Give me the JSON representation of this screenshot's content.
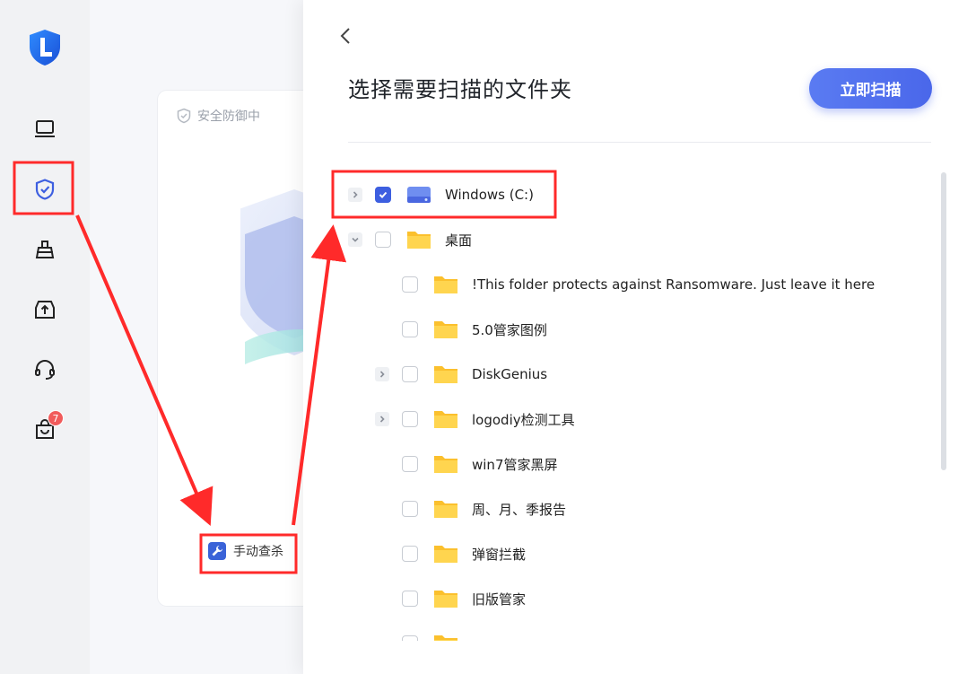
{
  "sidebar": {
    "items": [
      {
        "icon": "laptop-icon"
      },
      {
        "icon": "shield-check-icon"
      },
      {
        "icon": "broom-icon"
      },
      {
        "icon": "upload-box-icon"
      },
      {
        "icon": "headset-icon"
      },
      {
        "icon": "bag-icon",
        "badge": "7"
      }
    ]
  },
  "status": {
    "text": "安全防御中"
  },
  "manual": {
    "label": "手动查杀"
  },
  "drawer": {
    "title": "选择需要扫描的文件夹",
    "scan_button": "立即扫描"
  },
  "tree": [
    {
      "label": "Windows (C:)",
      "type": "drive",
      "level": 0,
      "expander": "collapsed",
      "checked": true
    },
    {
      "label": "桌面",
      "type": "folder",
      "level": 0,
      "expander": "expanded",
      "checked": false
    },
    {
      "label": "!This folder protects against Ransomware. Just leave it here",
      "type": "folder",
      "level": 1,
      "expander": "none",
      "checked": false
    },
    {
      "label": "5.0管家图例",
      "type": "folder",
      "level": 1,
      "expander": "none",
      "checked": false
    },
    {
      "label": "DiskGenius",
      "type": "folder",
      "level": 1,
      "expander": "collapsed",
      "checked": false
    },
    {
      "label": "logodiy检测工具",
      "type": "folder",
      "level": 1,
      "expander": "collapsed",
      "checked": false
    },
    {
      "label": "win7管家黑屏",
      "type": "folder",
      "level": 1,
      "expander": "none",
      "checked": false
    },
    {
      "label": "周、月、季报告",
      "type": "folder",
      "level": 1,
      "expander": "none",
      "checked": false
    },
    {
      "label": "弹窗拦截",
      "type": "folder",
      "level": 1,
      "expander": "none",
      "checked": false
    },
    {
      "label": "旧版管家",
      "type": "folder",
      "level": 1,
      "expander": "none",
      "checked": false
    },
    {
      "label": "",
      "type": "folder",
      "level": 1,
      "expander": "none",
      "checked": false
    }
  ],
  "colors": {
    "accent": "#3d5fe0",
    "folder": "#fbc02d",
    "annotation": "#ff2a2a"
  }
}
